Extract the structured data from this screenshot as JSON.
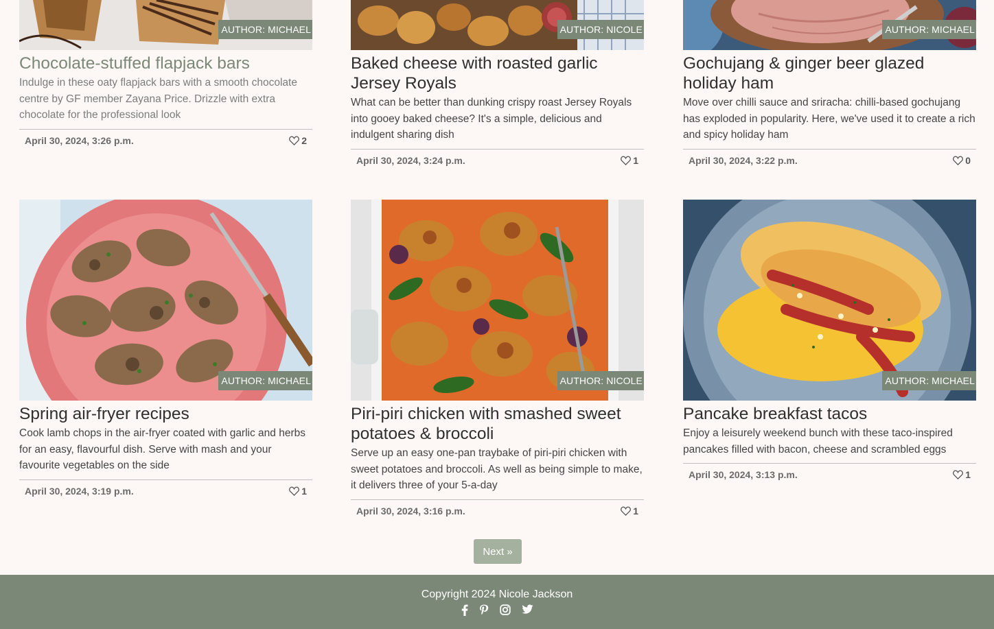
{
  "posts": [
    {
      "author": "AUTHOR: MICHAEL",
      "title": "Chocolate-stuffed flapjack bars",
      "excerpt": "Indulge in these oaty flapjack bars with a smooth chocolate centre by GF member Zayana Price. Drizzle with extra chocolate for the professional look",
      "date": "April 30, 2024, 3:26 p.m.",
      "likes": "2",
      "image": "flapjack-bars-photo"
    },
    {
      "author": "AUTHOR: NICOLE",
      "title": "Baked cheese with roasted garlic Jersey Royals",
      "excerpt": "What can be better than dunking crispy roast Jersey Royals into gooey baked cheese? It's a simple, delicious and indulgent sharing dish",
      "date": "April 30, 2024, 3:24 p.m.",
      "likes": "1",
      "image": "baked-cheese-potatoes-photo"
    },
    {
      "author": "AUTHOR: MICHAEL",
      "title": "Gochujang & ginger beer glazed holiday ham",
      "excerpt": "Move over chilli sauce and sriracha: chilli-based gochujang has exploded in popularity. Here, we've used it to create a rich and spicy holiday ham",
      "date": "April 30, 2024, 3:22 p.m.",
      "likes": "0",
      "image": "glazed-ham-photo"
    },
    {
      "author": "AUTHOR: MICHAEL",
      "title": "Spring air-fryer recipes",
      "excerpt": "Cook lamb chops in the air-fryer coated with garlic and herbs for an easy, flavourful dish. Serve with mash and your favourite vegetables on the side",
      "date": "April 30, 2024, 3:19 p.m.",
      "likes": "1",
      "image": "lamb-chops-photo"
    },
    {
      "author": "AUTHOR: NICOLE",
      "title": "Piri-piri chicken with smashed sweet potatoes & broccoli",
      "excerpt": "Serve up an easy one-pan traybake of piri-piri chicken with sweet potatoes and broccoli. As well as being simple to make, it delivers three of your 5-a-day",
      "date": "April 30, 2024, 3:16 p.m.",
      "likes": "1",
      "image": "piri-piri-chicken-photo"
    },
    {
      "author": "AUTHOR: MICHAEL",
      "title": "Pancake breakfast tacos",
      "excerpt": "Enjoy a leisurely weekend bunch with these taco-inspired pancakes filled with bacon, cheese and scrambled eggs",
      "date": "April 30, 2024, 3:13 p.m.",
      "likes": "1",
      "image": "pancake-tacos-photo"
    }
  ],
  "pagination": {
    "next_label": "Next »"
  },
  "footer": {
    "copyright": "Copyright 2024 Nicole Jackson",
    "socials": [
      "facebook-icon",
      "pinterest-icon",
      "instagram-icon",
      "twitter-icon"
    ]
  },
  "colors": {
    "background": "#fdf8f5",
    "accent": "#7b8877",
    "button": "#a3b19e"
  }
}
